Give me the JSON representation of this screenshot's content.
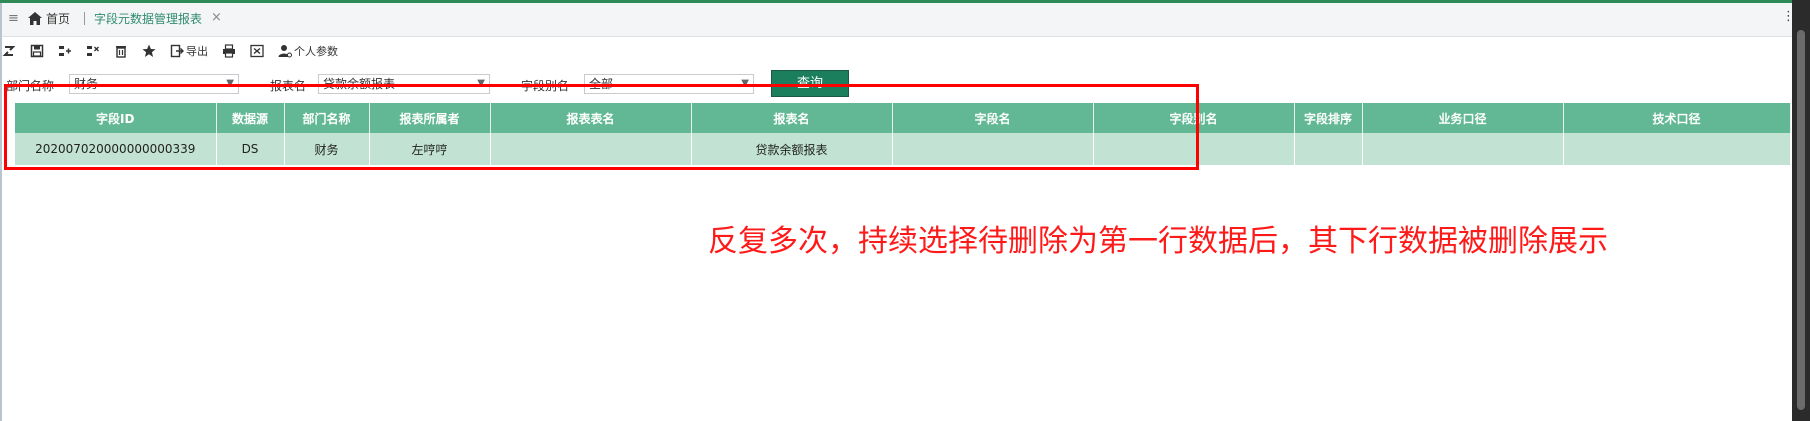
{
  "tabbar": {
    "home_label": "首页",
    "active_tab": "字段元数据管理报表"
  },
  "toolbar": {
    "items": [
      {
        "icon": "refresh-icon",
        "label": ""
      },
      {
        "icon": "save-icon",
        "label": ""
      },
      {
        "icon": "add-row-icon",
        "label": ""
      },
      {
        "icon": "delete-row-icon",
        "label": ""
      },
      {
        "icon": "trash-icon",
        "label": ""
      },
      {
        "icon": "star-icon",
        "label": ""
      },
      {
        "icon": "export-icon",
        "label": "导出"
      },
      {
        "icon": "print-icon",
        "label": ""
      },
      {
        "icon": "excel-icon",
        "label": ""
      },
      {
        "icon": "person-settings-icon",
        "label": "个人参数"
      }
    ]
  },
  "filters": {
    "dept_label": "部门名称",
    "dept_value": "财务",
    "report_label": "报表名",
    "report_value": "贷款余额报表",
    "field_label": "字段别名",
    "field_value": "全部",
    "query_button": "查询"
  },
  "grid": {
    "columns": [
      "字段ID",
      "数据源",
      "部门名称",
      "报表所属者",
      "报表表名",
      "报表名",
      "字段名",
      "字段别名",
      "字段排序",
      "业务口径",
      "技术口径"
    ],
    "rows": [
      [
        "202007020000000000339",
        "DS",
        "财务",
        "左哼哼",
        "",
        "贷款余额报表",
        "",
        "",
        "",
        "",
        ""
      ]
    ]
  },
  "annotation": "反复多次，持续选择待删除为第一行数据后，其下行数据被删除展示"
}
